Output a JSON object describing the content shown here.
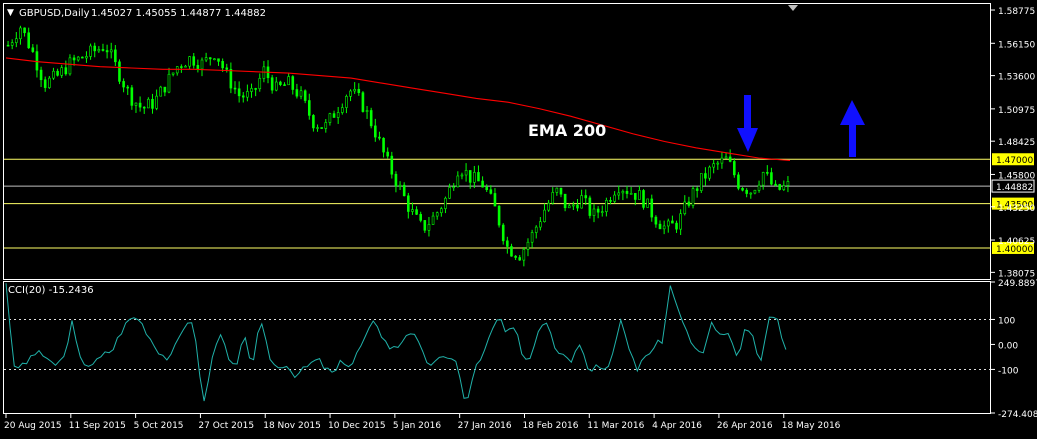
{
  "header": {
    "menu_glyph": "▼",
    "symbol": "GBPUSD,Daily",
    "ohlc": "1.45027 1.45055 1.44877 1.44882"
  },
  "indicator_header": "CCI(20) -15.2436",
  "annotation_text": "EMA 200",
  "colors": {
    "background": "#000000",
    "frame": "#ffffff",
    "candle": "#00ff00",
    "ema": "#ff0000",
    "cci": "#20b2aa",
    "level_line": "#ffff66",
    "price_line": "#c0c0c0",
    "arrow": "#0000ff"
  },
  "icons": {
    "down_arrow": "blue-down-arrow-icon",
    "up_arrow": "blue-up-arrow-icon",
    "scroll_marker": "triangle-marker-icon"
  },
  "chart_data": [
    {
      "type": "candlestick",
      "title": "GBPUSD,Daily",
      "price_axis_labels": [
        "1.58775",
        "1.56150",
        "1.53600",
        "1.50975",
        "1.48425",
        "1.45800",
        "1.43250",
        "1.40625",
        "1.38075"
      ],
      "ylim": [
        1.3755,
        1.5925
      ],
      "horizontal_levels": [
        {
          "value": 1.47,
          "label": "1.47000",
          "style": "highlight"
        },
        {
          "value": 1.435,
          "label": "1.43500",
          "style": "highlight"
        },
        {
          "value": 1.4,
          "label": "1.40000",
          "style": "highlight"
        },
        {
          "value": 1.44882,
          "label": "1.44882",
          "style": "bid"
        }
      ],
      "x_tick_labels": [
        "20 Aug 2015",
        "11 Sep 2015",
        "5 Oct 2015",
        "27 Oct 2015",
        "18 Nov 2015",
        "10 Dec 2015",
        "5 Jan 2016",
        "27 Jan 2016",
        "18 Feb 2016",
        "11 Mar 2016",
        "4 Apr 2016",
        "26 Apr 2016",
        "18 May 2016"
      ],
      "close_path": [
        1.56,
        1.575,
        1.555,
        1.53,
        1.535,
        1.545,
        1.55,
        1.555,
        1.56,
        1.54,
        1.52,
        1.51,
        1.515,
        1.53,
        1.545,
        1.55,
        1.545,
        1.555,
        1.535,
        1.52,
        1.52,
        1.54,
        1.525,
        1.53,
        1.52,
        1.5,
        1.495,
        1.51,
        1.525,
        1.515,
        1.495,
        1.47,
        1.45,
        1.43,
        1.415,
        1.425,
        1.44,
        1.465,
        1.455,
        1.45,
        1.43,
        1.4,
        1.395,
        1.41,
        1.43,
        1.445,
        1.43,
        1.44,
        1.425,
        1.435,
        1.45,
        1.445,
        1.44,
        1.425,
        1.415,
        1.42,
        1.44,
        1.455,
        1.465,
        1.47,
        1.45,
        1.445,
        1.46,
        1.445,
        1.449
      ],
      "ema_200": [
        1.55,
        1.547,
        1.545,
        1.543,
        1.542,
        1.541,
        1.541,
        1.54,
        1.539,
        1.538,
        1.536,
        1.534,
        1.53,
        1.526,
        1.522,
        1.518,
        1.515,
        1.51,
        1.504,
        1.497,
        1.49,
        1.484,
        1.479,
        1.475,
        1.471,
        1.469
      ],
      "annotations": [
        {
          "text": "EMA 200",
          "near": "EMA line"
        },
        {
          "marker": "down-arrow",
          "near": "26 Apr 2016 high"
        },
        {
          "marker": "up-arrow",
          "near": "right of 18 May 2016"
        }
      ]
    },
    {
      "type": "line",
      "title": "CCI(20) -15.2436",
      "series": [
        {
          "name": "CCI(20)",
          "values": [
            250,
            -100,
            -80,
            -60,
            -20,
            -70,
            -80,
            -60,
            90,
            -60,
            -80,
            -70,
            -40,
            -20,
            50,
            100,
            110,
            60,
            0,
            -40,
            -60,
            20,
            100,
            60,
            -250,
            -80,
            70,
            -60,
            -100,
            30,
            -80,
            90,
            -40,
            -100,
            -70,
            -120,
            -110,
            -80,
            -60,
            -100,
            -120,
            -60,
            -90,
            -20,
            40,
            100,
            20,
            -20,
            0,
            60,
            20,
            -60,
            -80,
            -60,
            -40,
            -80,
            -260,
            -100,
            -60,
            40,
            110,
            30,
            90,
            -60,
            -40,
            80,
            100,
            -20,
            -40,
            -60,
            20,
            -100,
            -80,
            -100,
            -30,
            100,
            -30,
            -100,
            -40,
            -10,
            20,
            250,
            120,
            40,
            -20,
            -40,
            90,
            30,
            40,
            -60,
            60,
            20,
            -80,
            120,
            90,
            -10
          ]
        }
      ],
      "axis_labels": [
        "249.8897",
        "100",
        "0.00",
        "-100",
        "-274.4083"
      ],
      "ylim": [
        -274.4083,
        249.8897
      ],
      "reference_levels": [
        100,
        -100
      ]
    }
  ]
}
